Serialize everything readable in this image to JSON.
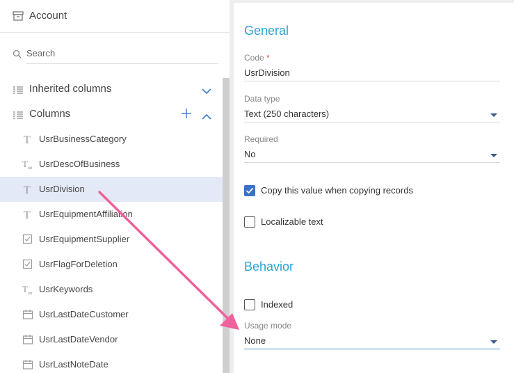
{
  "object_header": {
    "title": "Account",
    "icon": "archive-box-icon"
  },
  "search": {
    "placeholder": "Search"
  },
  "groups": {
    "inherited": {
      "label": "Inherited columns"
    },
    "columns": {
      "label": "Columns"
    }
  },
  "columns": [
    {
      "name": "UsrBusinessCategory",
      "icon": "text-type-icon",
      "selected": false
    },
    {
      "name": "UsrDescOfBusiness",
      "icon": "unlimited-text-icon",
      "selected": false
    },
    {
      "name": "UsrDivision",
      "icon": "text-type-icon",
      "selected": true
    },
    {
      "name": "UsrEquipmentAffiliation",
      "icon": "text-type-icon",
      "selected": false
    },
    {
      "name": "UsrEquipmentSupplier",
      "icon": "boolean-checkbox-icon",
      "selected": false
    },
    {
      "name": "UsrFlagForDeletion",
      "icon": "boolean-checkbox-icon",
      "selected": false
    },
    {
      "name": "UsrKeywords",
      "icon": "unlimited-text-icon",
      "selected": false
    },
    {
      "name": "UsrLastDateCustomer",
      "icon": "calendar-icon",
      "selected": false
    },
    {
      "name": "UsrLastDateVendor",
      "icon": "calendar-icon",
      "selected": false
    },
    {
      "name": "UsrLastNoteDate",
      "icon": "calendar-icon",
      "selected": false
    }
  ],
  "general": {
    "title": "General",
    "code": {
      "label": "Code",
      "required_mark": "*",
      "value": "UsrDivision"
    },
    "data_type": {
      "label": "Data type",
      "value": "Text (250 characters)"
    },
    "required": {
      "label": "Required",
      "value": "No"
    },
    "copy_value": {
      "label": "Copy this value when copying records",
      "checked": true
    },
    "localizable": {
      "label": "Localizable text",
      "checked": false
    }
  },
  "behavior": {
    "title": "Behavior",
    "indexed": {
      "label": "Indexed",
      "checked": false
    },
    "usage_mode": {
      "label": "Usage mode",
      "value": "None"
    }
  },
  "colors": {
    "accent": "#29a3d3",
    "selected_row": "#e3e9f7",
    "checkbox": "#3a73c6",
    "annotation_arrow": "#f0609a"
  }
}
